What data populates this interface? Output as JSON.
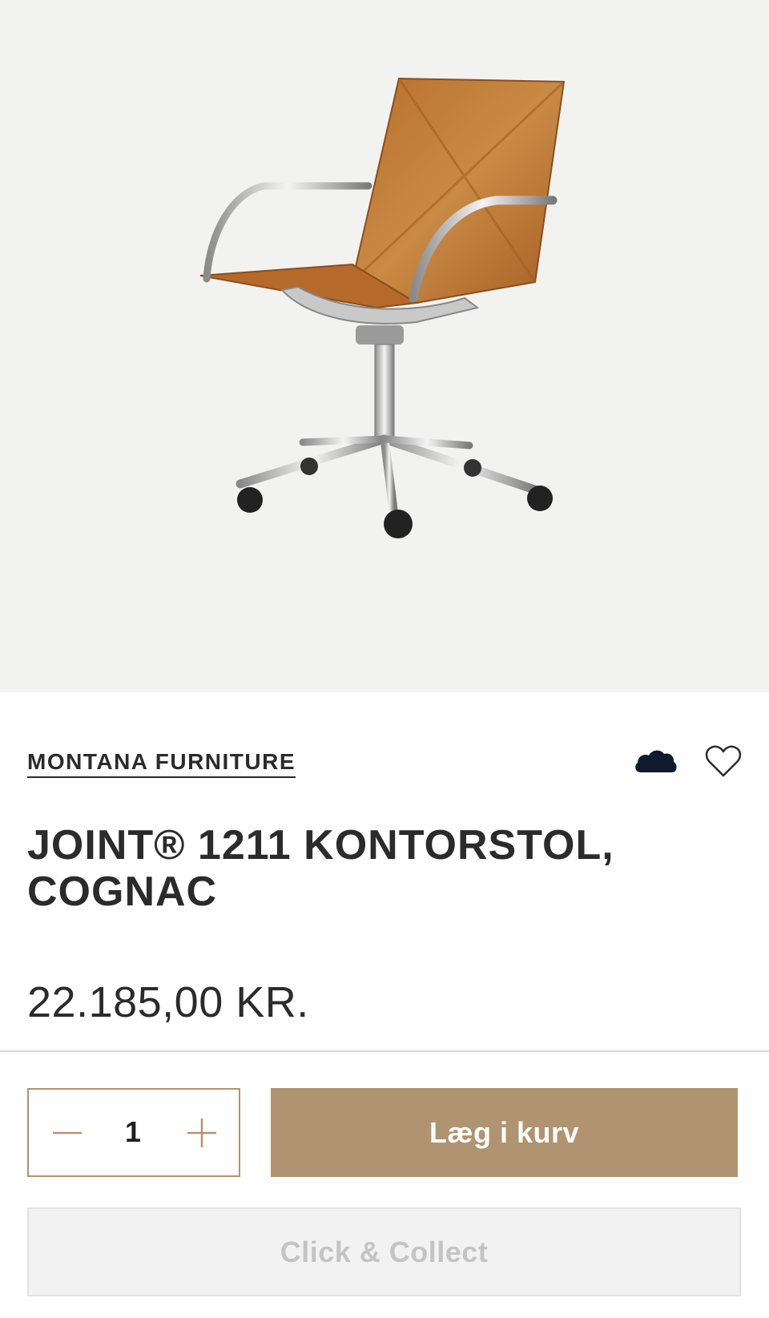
{
  "product_image": {
    "alt": "",
    "icon": "office-chair-image"
  },
  "brand": {
    "label": "MONTANA FURNITURE"
  },
  "icons": {
    "cloud": "cloud-icon",
    "favorite": "heart-icon"
  },
  "product": {
    "title": "JOINT® 1211 KONTORSTOL, COGNAC",
    "price": "22.185,00 KR."
  },
  "quantity": {
    "value": "1",
    "decrement_icon": "minus-icon",
    "increment_icon": "plus-icon"
  },
  "actions": {
    "add_to_cart": "Læg i kurv",
    "click_collect": "Click & Collect"
  },
  "colors": {
    "accent": "#b09370",
    "text": "#2b2b2b",
    "hero_bg": "#f2f2f1",
    "disabled_bg": "#f2f2f2",
    "disabled_text": "#c4c4c4",
    "cloud": "#0f1a2e"
  }
}
